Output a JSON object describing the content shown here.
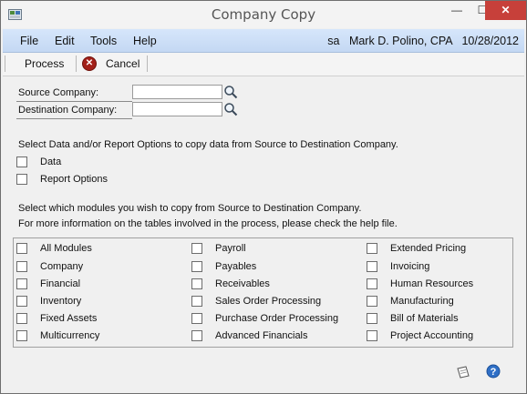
{
  "window": {
    "title": "Company Copy",
    "min_glyph": "—",
    "max_glyph": "☐",
    "close_glyph": "✕"
  },
  "menu": {
    "items": [
      "File",
      "Edit",
      "Tools",
      "Help"
    ]
  },
  "user": {
    "id": "sa",
    "name": "Mark D. Polino, CPA",
    "date": "10/28/2012"
  },
  "toolbar": {
    "process_label": "Process",
    "cancel_label": "Cancel"
  },
  "form": {
    "source_label": "Source Company:",
    "source_value": "",
    "dest_label": "Destination Company:",
    "dest_value": ""
  },
  "options": {
    "instruction": "Select Data and/or Report Options to copy data from Source to Destination Company.",
    "data_label": "Data",
    "data_checked": false,
    "report_label": "Report Options",
    "report_checked": false
  },
  "modules": {
    "instruction1": "Select which modules you wish to copy from Source to Destination Company.",
    "instruction2": "For more information on the tables involved in the process, please check the help file.",
    "col1": [
      "All Modules",
      "Company",
      "Financial",
      "Inventory",
      "Fixed Assets",
      "Multicurrency"
    ],
    "col2": [
      "Payroll",
      "Payables",
      "Receivables",
      "Sales Order Processing",
      "Purchase Order Processing",
      "Advanced Financials"
    ],
    "col3": [
      "Extended Pricing",
      "Invoicing",
      "Human Resources",
      "Manufacturing",
      "Bill of Materials",
      "Project Accounting"
    ]
  },
  "icons": {
    "lookup": "magnifier-icon",
    "note": "note-icon",
    "help": "help-icon",
    "cancel": "cancel-x-icon"
  },
  "colors": {
    "menubar": "#c9dcf5",
    "close_button": "#c7403a",
    "cancel_icon": "#a3211a",
    "help_icon": "#2f6fc6"
  }
}
